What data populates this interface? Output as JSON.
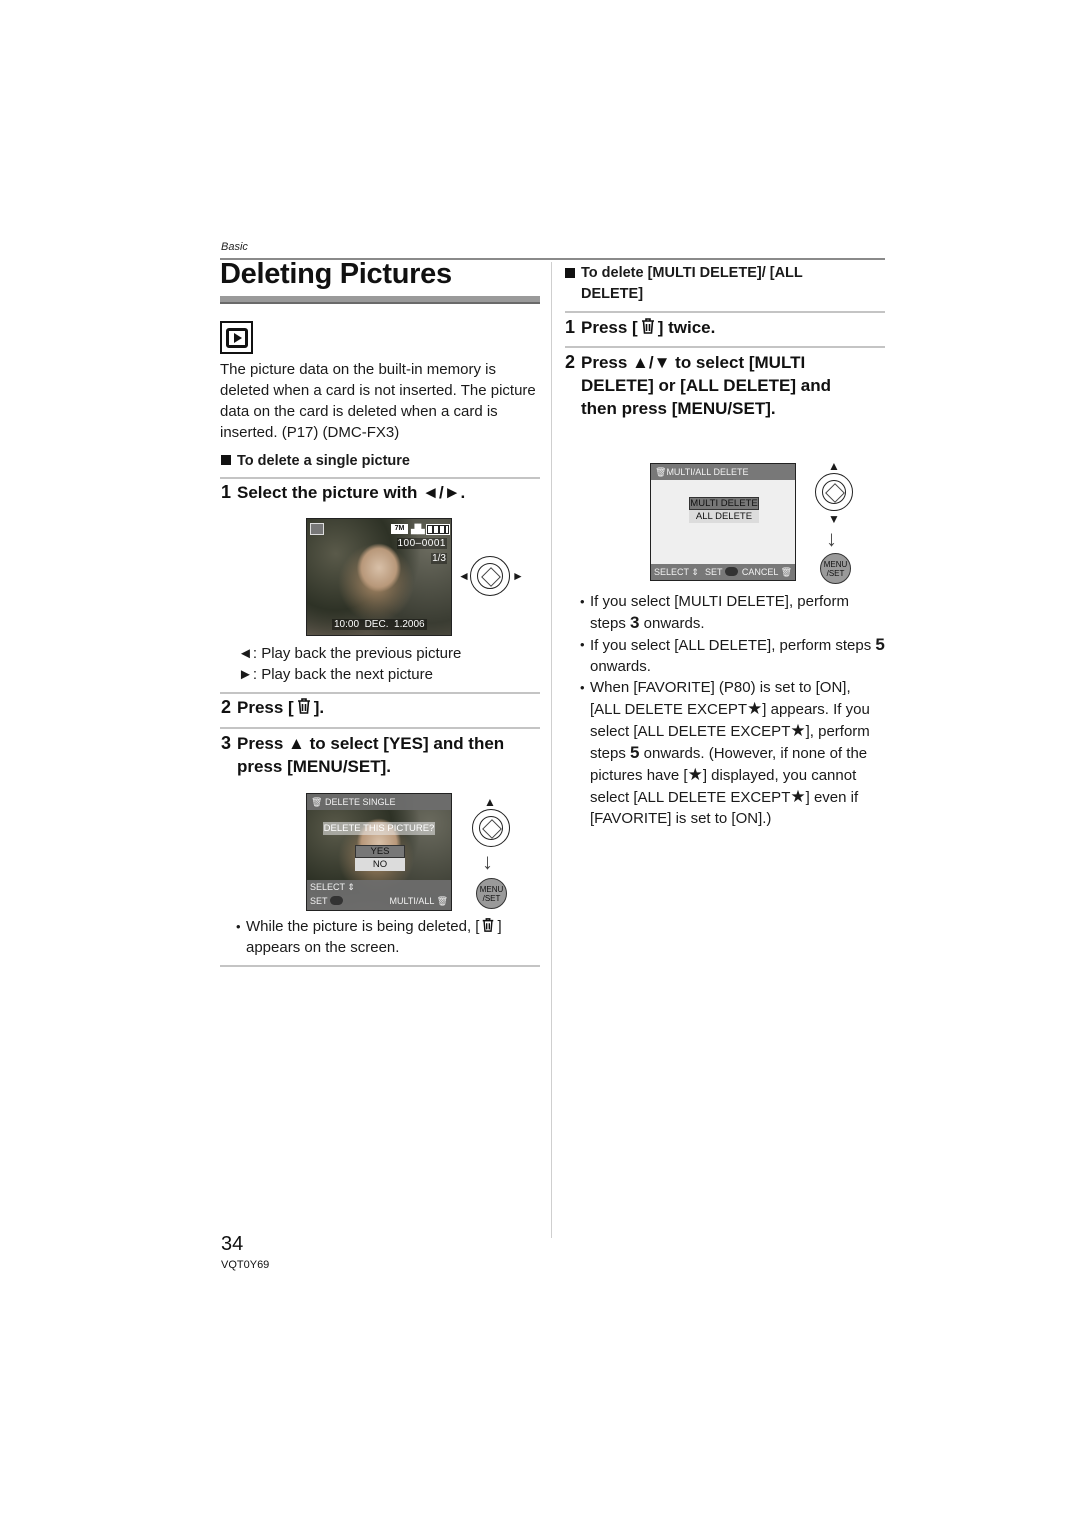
{
  "header": {
    "section": "Basic",
    "title": "Deleting Pictures",
    "mode_icon": "playback-mode-icon"
  },
  "left": {
    "intro": "The picture data on the built-in memory is deleted when a card is not inserted. The picture data on the card is deleted when a card is inserted. (P17) (DMC-FX3)",
    "single_heading": "To delete a single picture",
    "step1": {
      "num": "1",
      "text": "Select the picture with ◄/►."
    },
    "screen1": {
      "resolution": "7M",
      "file_no": "100–0001",
      "counter": "1/3",
      "datetime": "10:00  DEC.  1.2006"
    },
    "legend": [
      {
        "key": "◄",
        "text": ": Play back the previous picture"
      },
      {
        "key": "►",
        "text": ": Play back the next picture"
      }
    ],
    "step2": {
      "num": "2",
      "pre": "Press [",
      "post": "]."
    },
    "step3": {
      "num": "3",
      "text": "Press ▲ to select [YES] and then press [MENU/SET]."
    },
    "screen2": {
      "title": "DELETE SINGLE",
      "question": "DELETE THIS PICTURE?",
      "options": [
        "YES",
        "NO"
      ],
      "selected": "YES",
      "footer_select": "SELECT",
      "footer_set": "SET",
      "footer_right": "MULTI/ALL"
    },
    "note": {
      "pre": "While the picture is being deleted, [",
      "post": "] appears on the screen."
    }
  },
  "right": {
    "multi_heading": "To delete [MULTI DELETE]/ [ALL DELETE]",
    "step1": {
      "num": "1",
      "pre": "Press [",
      "post": "] twice."
    },
    "step2": {
      "num": "2",
      "text": "Press ▲/▼ to select [MULTI DELETE] or [ALL DELETE] and then press [MENU/SET]."
    },
    "screen3": {
      "title": "MULTI/ALL DELETE",
      "options": [
        "MULTI DELETE",
        "ALL DELETE"
      ],
      "selected": "MULTI DELETE",
      "footer_select": "SELECT",
      "footer_set": "SET",
      "footer_cancel": "CANCEL"
    },
    "menu_button": {
      "line1": "MENU",
      "line2": "/SET"
    },
    "bullets": [
      {
        "a": "If you select [MULTI DELETE], perform steps ",
        "n": "3",
        "b": " onwards."
      },
      {
        "a": "If you select [ALL DELETE], perform steps ",
        "n": "5",
        "b": " onwards."
      }
    ],
    "favorite_bullet": {
      "p1": "When [FAVORITE] (P80) is set to [ON], [ALL DELETE EXCEPT",
      "p2": "] appears. If you select [ALL DELETE EXCEPT",
      "p3": "], perform steps ",
      "n": "5",
      "p4": " onwards. (However, if none of the pictures have [",
      "p5": "] displayed, you cannot select [ALL DELETE EXCEPT",
      "p6": "] even if [FAVORITE] is set to [ON].)"
    }
  },
  "footer": {
    "page_number": "34",
    "doc_code": "VQT0Y69"
  }
}
